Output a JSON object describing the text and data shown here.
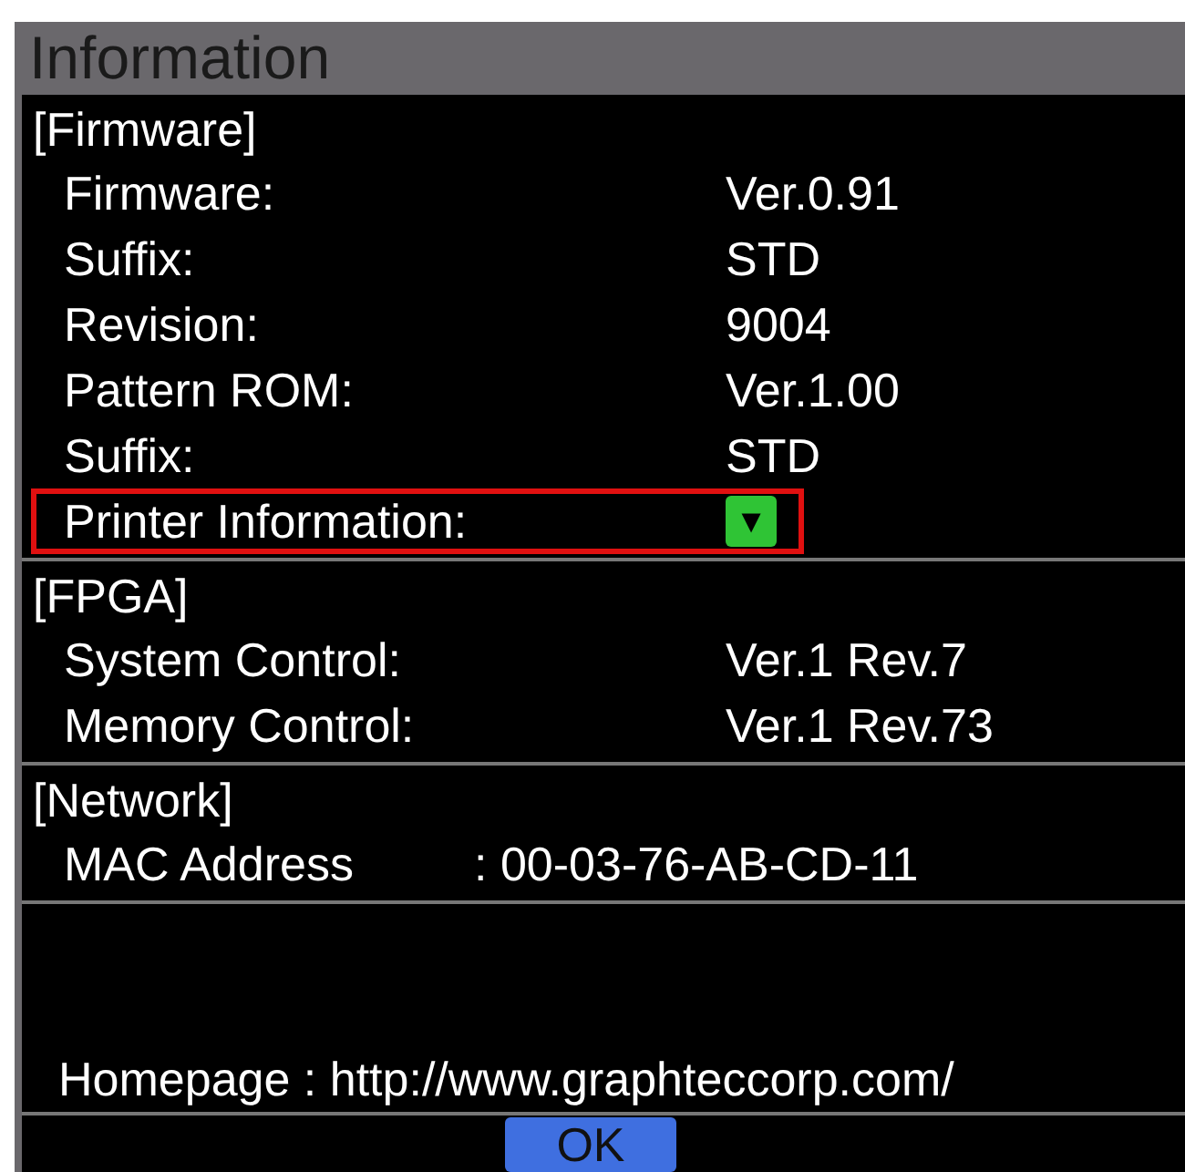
{
  "window": {
    "title": "Information"
  },
  "sections": [
    {
      "heading": "[Firmware]",
      "rows": [
        {
          "kind": "text",
          "label": "Firmware:",
          "value": "Ver.0.91",
          "highlighted": false
        },
        {
          "kind": "text",
          "label": "Suffix:",
          "value": "STD",
          "highlighted": false
        },
        {
          "kind": "text",
          "label": "Revision:",
          "value": "9004",
          "highlighted": false
        },
        {
          "kind": "text",
          "label": "Pattern ROM:",
          "value": "Ver.1.00",
          "highlighted": false
        },
        {
          "kind": "text",
          "label": "Suffix:",
          "value": "STD",
          "highlighted": false
        },
        {
          "kind": "button",
          "label": "Printer Information:",
          "symbol": "▼",
          "highlighted": true
        }
      ]
    },
    {
      "heading": "[FPGA]",
      "rows": [
        {
          "kind": "text",
          "label": "System Control:",
          "value": "Ver.1 Rev.7",
          "highlighted": false
        },
        {
          "kind": "text",
          "label": "Memory Control:",
          "value": "Ver.1 Rev.73",
          "highlighted": false
        }
      ]
    },
    {
      "heading": "[Network]",
      "rows": [
        {
          "kind": "inline",
          "label": "MAC Address",
          "value": ": 00-03-76-AB-CD-11",
          "highlighted": false
        }
      ]
    }
  ],
  "homepage": "Homepage : http://www.graphteccorp.com/",
  "ok_button": "OK"
}
